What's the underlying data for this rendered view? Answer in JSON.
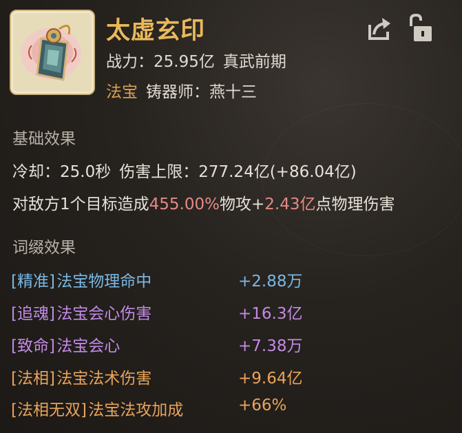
{
  "item": {
    "title": "太虚玄印",
    "power_label": "战力：",
    "power_value": "25.95亿",
    "realm": "真武前期",
    "category": "法宝",
    "smith_label": "铸器师：",
    "smith_name": "燕十三"
  },
  "base": {
    "title": "基础效果",
    "cooldown_label": "冷却：",
    "cooldown_value": "25.0秒",
    "cap_label": "伤害上限：",
    "cap_value": "277.24亿(+86.04亿)",
    "desc_prefix": "对敌方1个目标造成",
    "desc_pct": "455.00%",
    "desc_mid": "物攻+",
    "desc_amount": "2.43亿",
    "desc_suffix": "点物理伤害"
  },
  "affixes": {
    "title": "词缀效果",
    "items": [
      {
        "tag": "[精准]",
        "name": "法宝物理命中",
        "value": "+2.88万",
        "color": "#7ab8e4"
      },
      {
        "tag": "[追魂]",
        "name": "法宝会心伤害",
        "value": "+16.3亿",
        "color": "#c38ae6"
      },
      {
        "tag": "[致命]",
        "name": "法宝会心",
        "value": "+7.38万",
        "color": "#c38ae6"
      },
      {
        "tag": "[法相]",
        "name": "法宝法术伤害",
        "value": "+9.64亿",
        "color": "#e9a45a"
      },
      {
        "tag": "[法相无双]",
        "name": "法宝法攻加成",
        "value": "+66%",
        "color": "#e9a45a"
      }
    ]
  },
  "icons": {
    "share": "share-icon",
    "lock": "unlock-icon",
    "item": "seal-treasure-icon"
  },
  "colors": {
    "title": "#e9b95b",
    "category": "#d8a256",
    "highlight_red": "#e58a86"
  }
}
